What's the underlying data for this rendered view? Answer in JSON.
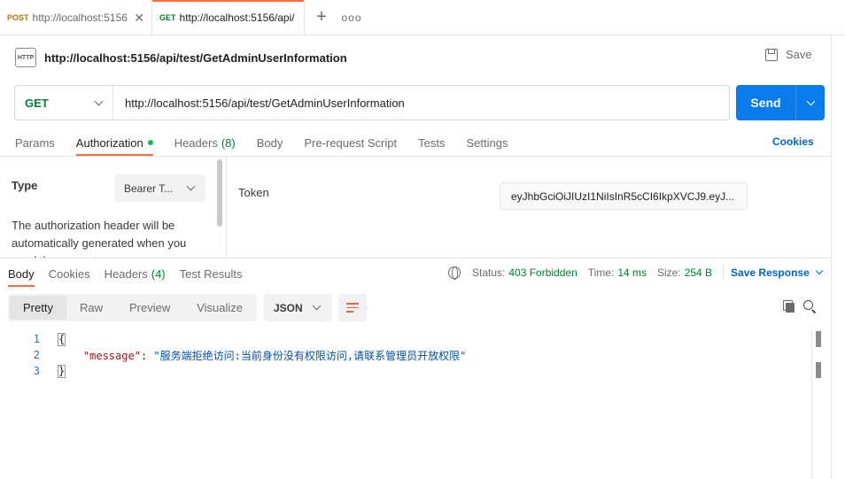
{
  "tabs": [
    {
      "method": "POST",
      "url": "http://localhost:5156",
      "active": false
    },
    {
      "method": "GET",
      "url": "http://localhost:5156/api/",
      "active": true
    }
  ],
  "tab_actions": {
    "add": "+",
    "more": "ooo"
  },
  "request": {
    "icon_label": "HTTP",
    "title": "http://localhost:5156/api/test/GetAdminUserInformation",
    "save_label": "Save",
    "method": "GET",
    "url": "http://localhost:5156/api/test/GetAdminUserInformation",
    "send_label": "Send"
  },
  "request_tabs": [
    {
      "label": "Params"
    },
    {
      "label": "Authorization",
      "active": true,
      "dot": true
    },
    {
      "label": "Headers",
      "count": "(8)"
    },
    {
      "label": "Body"
    },
    {
      "label": "Pre-request Script"
    },
    {
      "label": "Tests"
    },
    {
      "label": "Settings"
    }
  ],
  "cookies_label": "Cookies",
  "auth": {
    "type_label": "Type",
    "type_value": "Bearer T...",
    "description": "The authorization header will be automatically generated when you send the request.",
    "token_label": "Token",
    "token_value": "eyJhbGciOiJIUzI1NiIsInR5cCI6IkpXVCJ9.eyJ..."
  },
  "response_tabs": [
    {
      "label": "Body",
      "active": true
    },
    {
      "label": "Cookies"
    },
    {
      "label": "Headers",
      "count": "(4)"
    },
    {
      "label": "Test Results"
    }
  ],
  "response_meta": {
    "status_key": "Status:",
    "status_value": "403 Forbidden",
    "time_key": "Time:",
    "time_value": "14 ms",
    "size_key": "Size:",
    "size_value": "254 B",
    "save_response_label": "Save Response"
  },
  "view_modes": [
    "Pretty",
    "Raw",
    "Preview",
    "Visualize"
  ],
  "active_view": "Pretty",
  "format": "JSON",
  "code_lines": [
    {
      "n": "1",
      "text": "{"
    },
    {
      "n": "2",
      "key": "\"message\"",
      "colon": ": ",
      "value": "\"服务端拒绝访问:当前身份没有权限访问,请联系管理员开放权限\""
    },
    {
      "n": "3",
      "text": "}"
    }
  ],
  "colors": {
    "accent": "#ff6c37",
    "send": "#097bed",
    "get": "#007f31",
    "post": "#ad7a03",
    "link": "#0265d2",
    "status_ok": "#007f31"
  }
}
